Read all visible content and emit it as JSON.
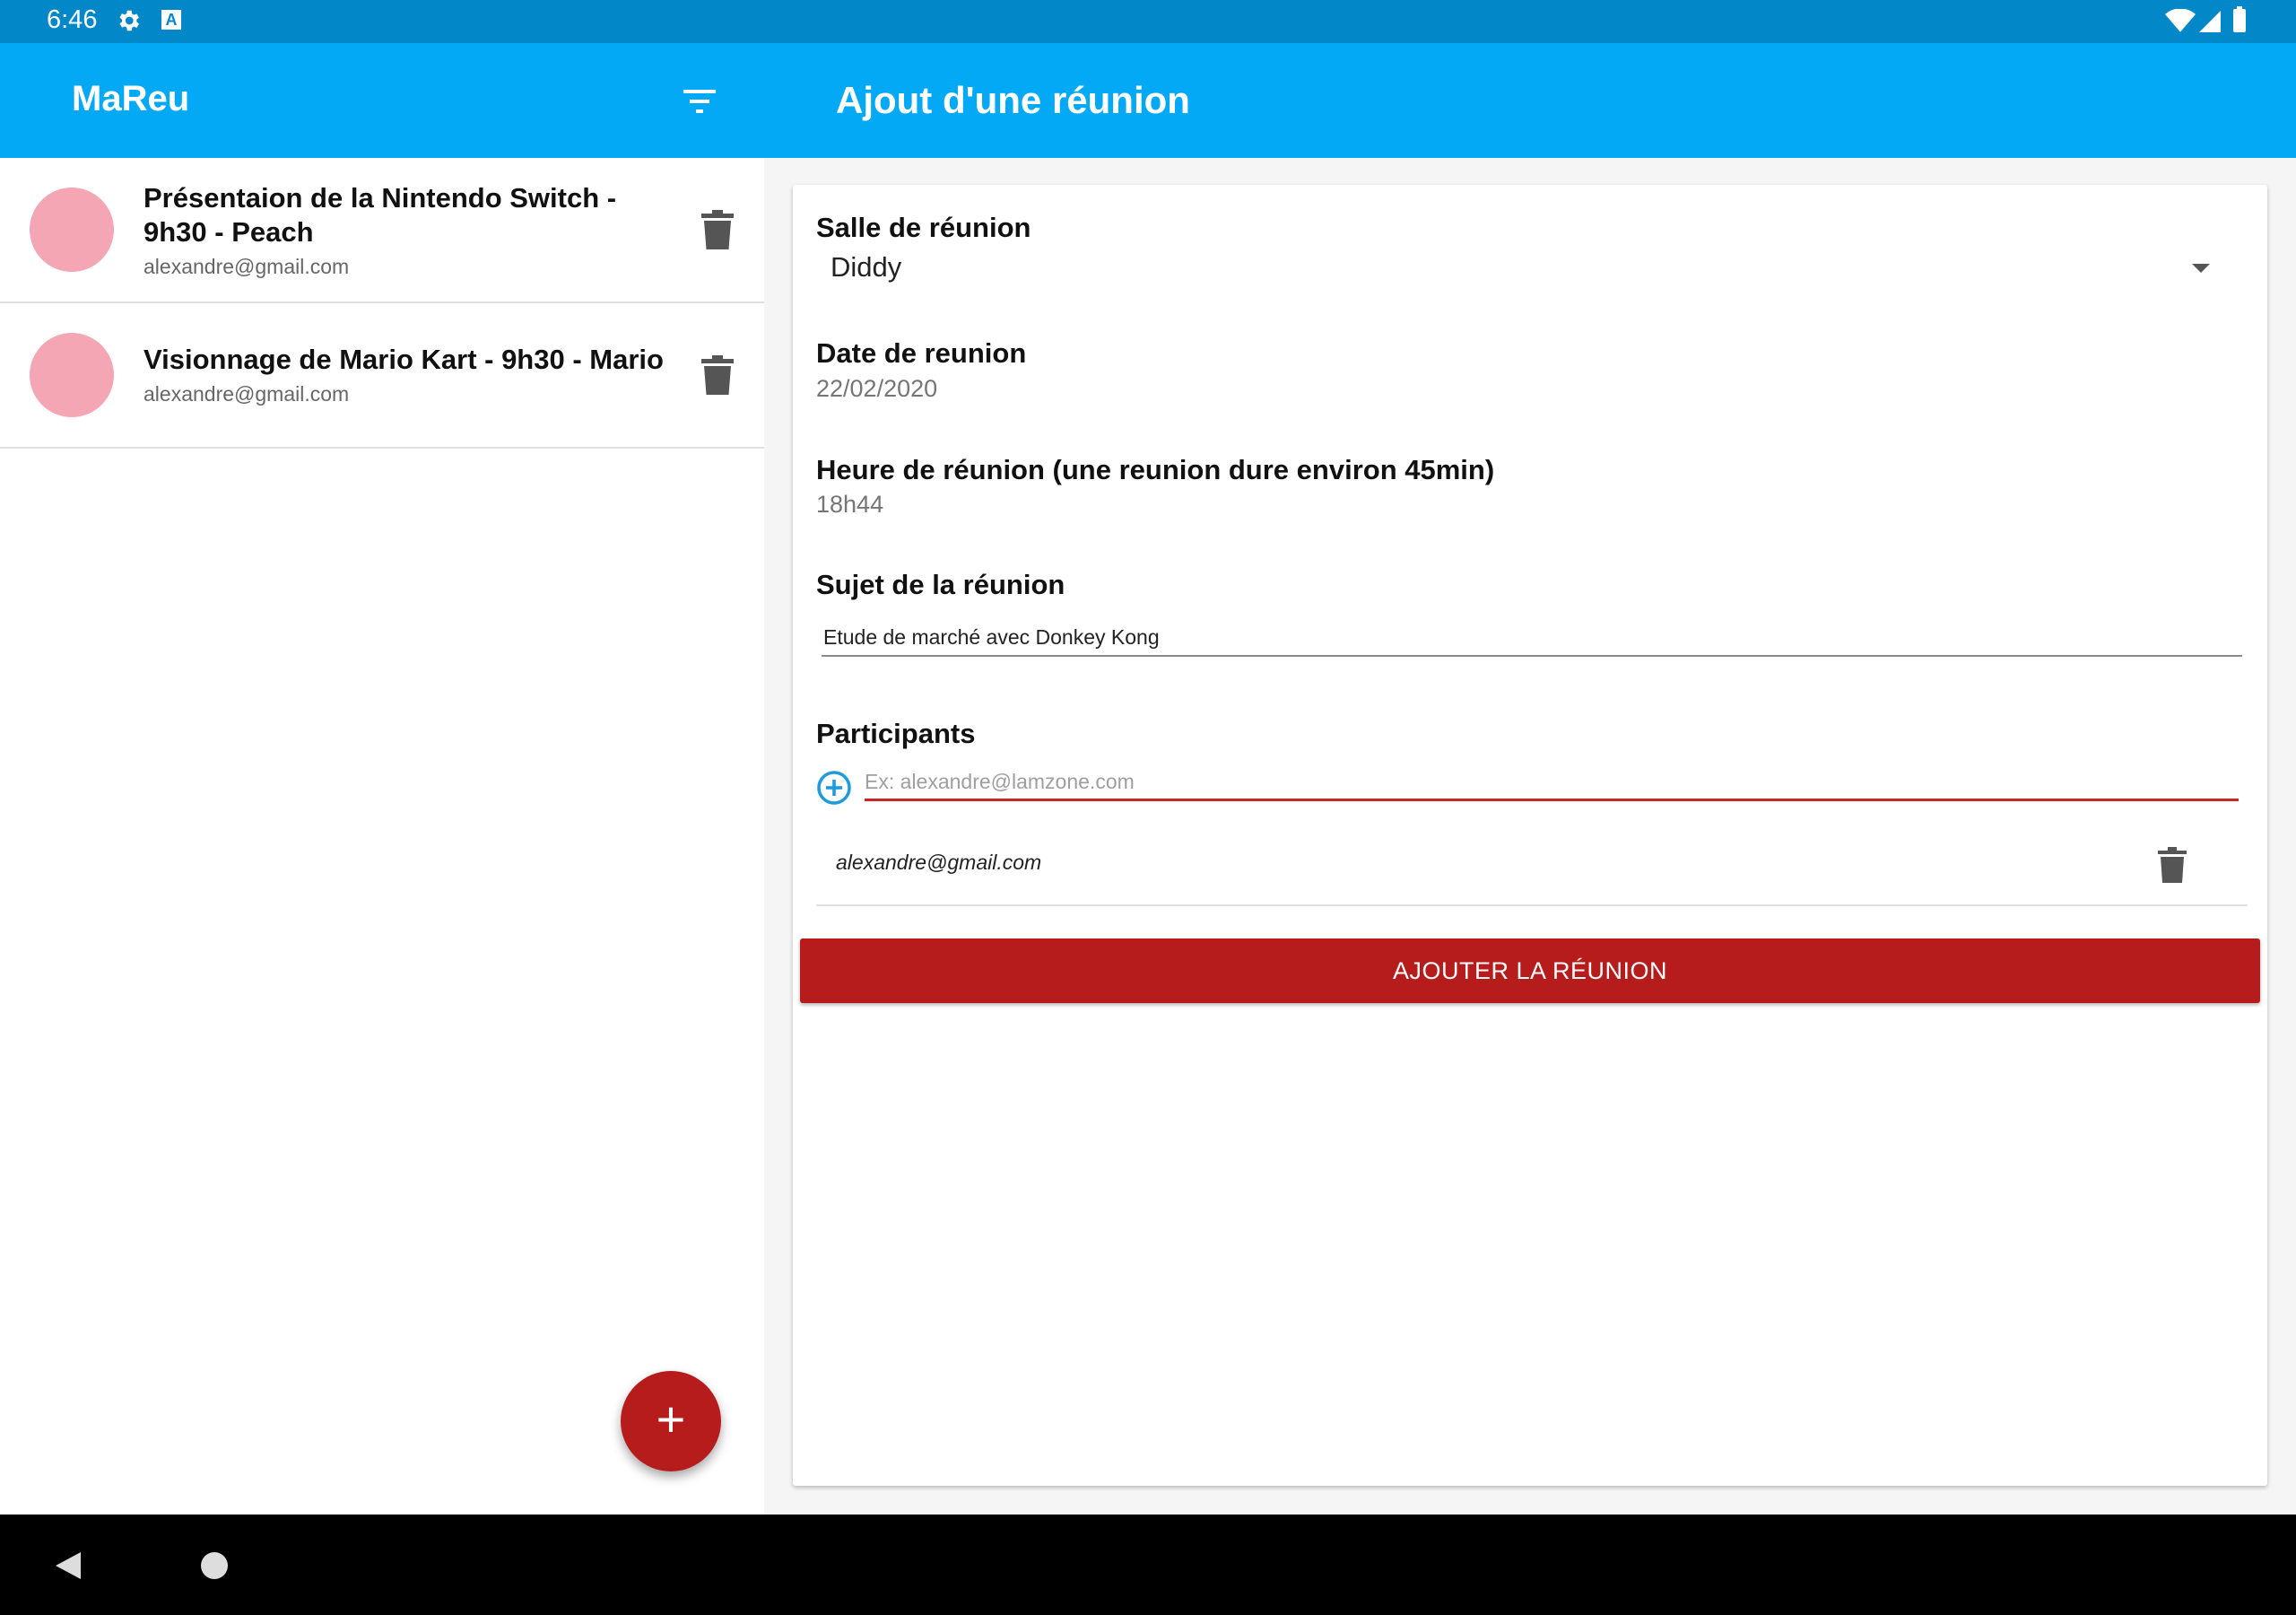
{
  "status_bar": {
    "time": "6:46"
  },
  "app_bar": {
    "app_title": "MaReu",
    "page_title": "Ajout d'une réunion"
  },
  "meetings": [
    {
      "title": "Présentaion de la Nintendo Switch - 9h30 - Peach",
      "participants": "alexandre@gmail.com",
      "avatar_color": "#f4a6b4"
    },
    {
      "title": "Visionnage de Mario Kart - 9h30 - Mario",
      "participants": "alexandre@gmail.com",
      "avatar_color": "#f4a6b4"
    }
  ],
  "form": {
    "room_label": "Salle de réunion",
    "room_value": "Diddy",
    "date_label": "Date de reunion",
    "date_value": "22/02/2020",
    "time_label": "Heure de réunion (une reunion dure environ 45min)",
    "time_value": "18h44",
    "subject_label": "Sujet de la réunion",
    "subject_value": "Etude de marché avec Donkey Kong",
    "participants_label": "Participants",
    "participant_placeholder": "Ex: alexandre@lamzone.com",
    "participants": [
      "alexandre@gmail.com"
    ],
    "submit_label": "AJOUTER LA RÉUNION"
  },
  "fab": {
    "label": "+"
  },
  "colors": {
    "primary": "#03a9f4",
    "primary_dark": "#0288c8",
    "accent": "#b71c1c",
    "avatar": "#f4a6b4"
  }
}
